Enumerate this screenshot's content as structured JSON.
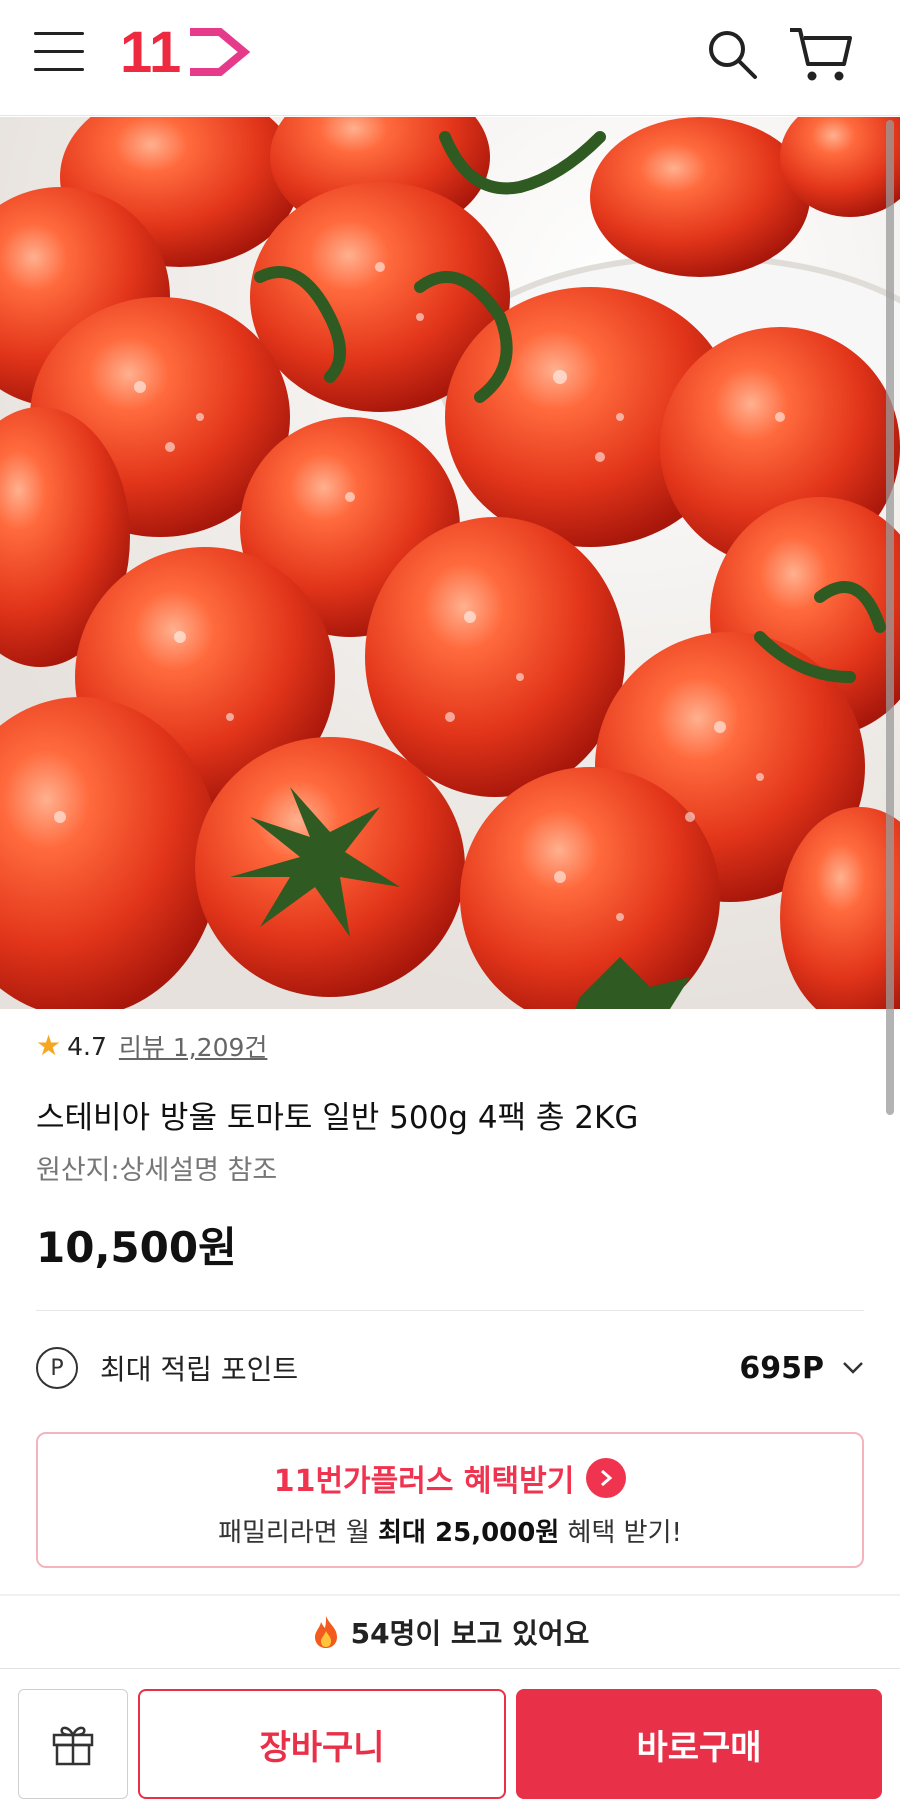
{
  "header": {
    "logo_text": "11",
    "brand_color": "#ee2a40",
    "icons": [
      "menu-icon",
      "search-icon",
      "cart-icon"
    ]
  },
  "product": {
    "rating": "4.7",
    "review_label": "리뷰 1,209건",
    "title": "스테비아 방울 토마토 일반 500g 4팩 총 2KG",
    "origin": "원산지:상세설명 참조",
    "price": "10,500원"
  },
  "points": {
    "icon_text": "P",
    "label": "최대 적립 포인트",
    "value": "695P"
  },
  "promo": {
    "title": "11번가플러스 혜택받기",
    "sub_prefix": "패밀리라면 월 ",
    "sub_bold": "최대 25,000원",
    "sub_suffix": " 혜택 받기!",
    "accent": "#f0334f"
  },
  "viewers": {
    "text": "54명이 보고 있어요"
  },
  "bottom": {
    "cart_label": "장바구니",
    "buy_label": "바로구매",
    "accent": "#e83048"
  }
}
